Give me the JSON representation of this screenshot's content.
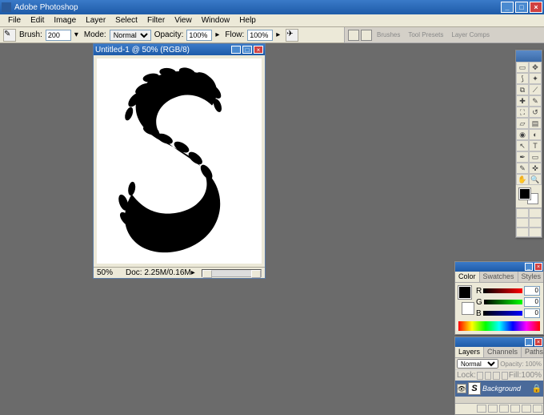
{
  "app": {
    "title": "Adobe Photoshop"
  },
  "menu": [
    "File",
    "Edit",
    "Image",
    "Layer",
    "Select",
    "Filter",
    "View",
    "Window",
    "Help"
  ],
  "options": {
    "brush_label": "Brush:",
    "brush_size": "200",
    "mode_label": "Mode:",
    "mode_value": "Normal",
    "opacity_label": "Opacity:",
    "opacity_value": "100%",
    "flow_label": "Flow:",
    "flow_value": "100%"
  },
  "palette_well": {
    "tabs": [
      "Brushes",
      "Tool Presets",
      "Layer Comps"
    ]
  },
  "document": {
    "title": "Untitled-1 @ 50% (RGB/8)",
    "zoom": "50%",
    "info": "Doc: 2.25M/0.16M"
  },
  "color_panel": {
    "tabs": [
      "Color",
      "Swatches",
      "Styles"
    ],
    "r_label": "R",
    "g_label": "G",
    "b_label": "B",
    "r_value": "0",
    "g_value": "0",
    "b_value": "0"
  },
  "layers_panel": {
    "tabs": [
      "Layers",
      "Channels",
      "Paths"
    ],
    "blend_mode": "Normal",
    "opacity_label": "Opacity:",
    "opacity_value": "100%",
    "lock_label": "Lock:",
    "fill_label": "Fill:",
    "fill_value": "100%",
    "layer_name": "Background"
  },
  "toolbox": {
    "tools": [
      "move",
      "marquee",
      "lasso",
      "wand",
      "crop",
      "slice",
      "heal",
      "brush",
      "stamp",
      "history",
      "eraser",
      "gradient",
      "blur",
      "dodge",
      "path",
      "type",
      "pen",
      "shape",
      "notes",
      "eyedrop",
      "hand",
      "zoom"
    ]
  }
}
